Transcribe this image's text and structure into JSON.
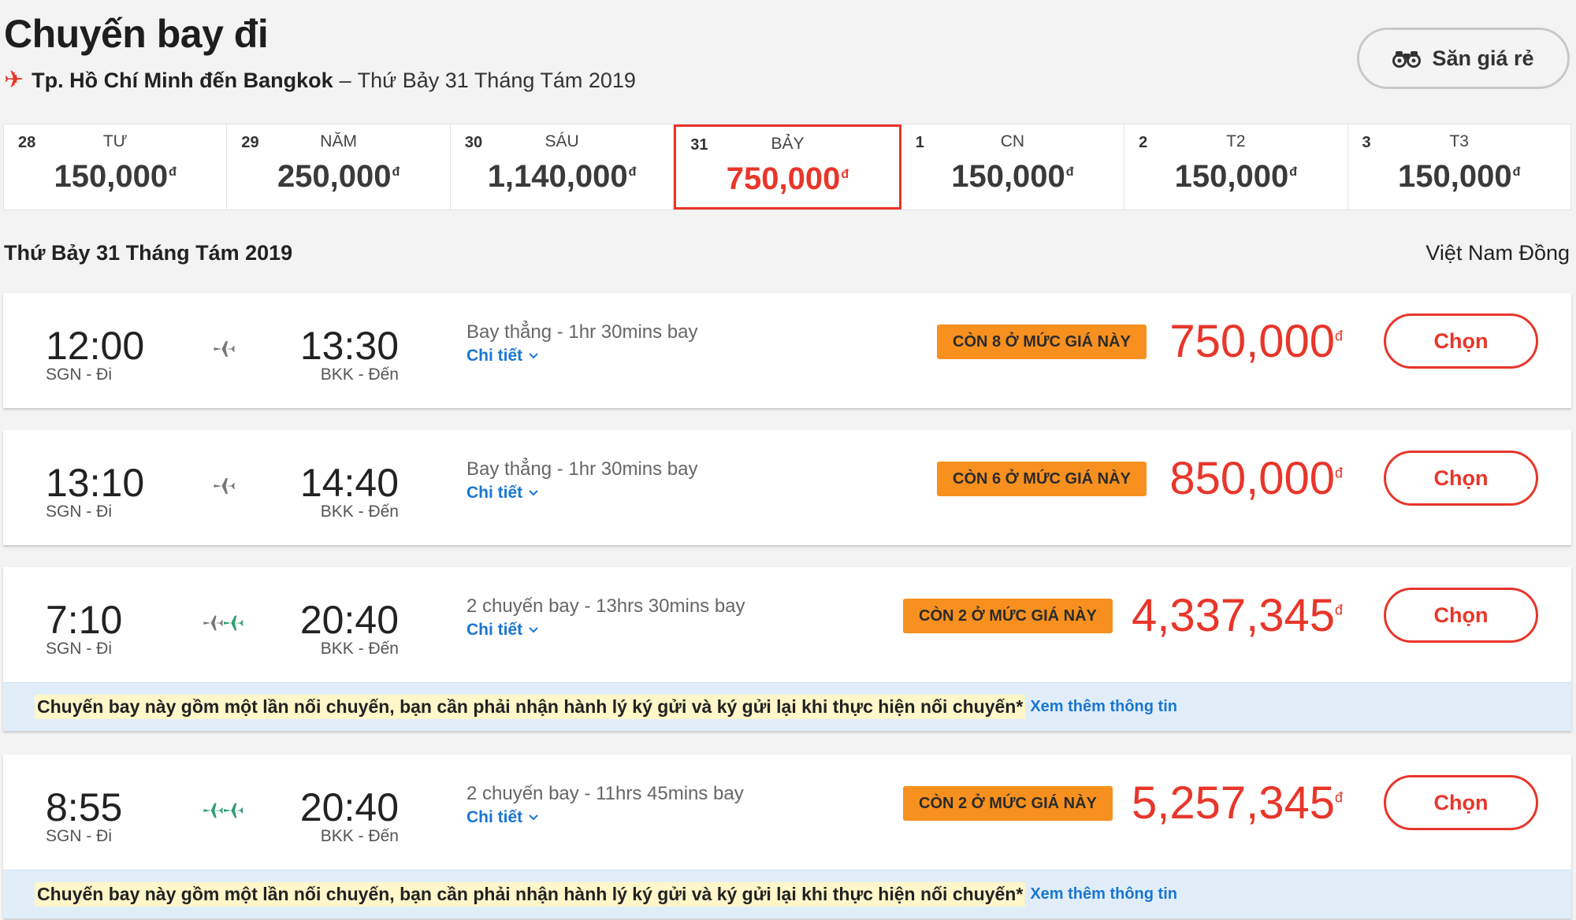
{
  "header": {
    "title": "Chuyến bay đi",
    "route": "Tp. Hồ Chí Minh đến Bangkok",
    "separator": "–",
    "date": "Thứ Bảy 31 Tháng Tám 2019",
    "deal_button_label": "Săn giá rẻ"
  },
  "date_strip": [
    {
      "day": "28",
      "weekday": "TƯ",
      "price": "150,000",
      "currency": "đ",
      "selected": false
    },
    {
      "day": "29",
      "weekday": "NĂM",
      "price": "250,000",
      "currency": "đ",
      "selected": false
    },
    {
      "day": "30",
      "weekday": "SÁU",
      "price": "1,140,000",
      "currency": "đ",
      "selected": false
    },
    {
      "day": "31",
      "weekday": "BẢY",
      "price": "750,000",
      "currency": "đ",
      "selected": true
    },
    {
      "day": "1",
      "weekday": "CN",
      "price": "150,000",
      "currency": "đ",
      "selected": false
    },
    {
      "day": "2",
      "weekday": "T2",
      "price": "150,000",
      "currency": "đ",
      "selected": false
    },
    {
      "day": "3",
      "weekday": "T3",
      "price": "150,000",
      "currency": "đ",
      "selected": false
    }
  ],
  "results": {
    "date_heading": "Thứ Bảy 31 Tháng Tám 2019",
    "currency_label": "Việt Nam Đồng"
  },
  "flights": [
    {
      "dep_time": "12:00",
      "dep_place": "SGN - Đi",
      "arr_time": "13:30",
      "arr_place": "BKK - Đến",
      "info": "Bay thẳng - 1hr 30mins bay",
      "details_label": "Chi tiết",
      "seats_label": "CÒN 8 Ở MỨC GIÁ NÀY",
      "price": "750,000",
      "currency": "đ",
      "choose_label": "Chọn",
      "connecting": false
    },
    {
      "dep_time": "13:10",
      "dep_place": "SGN - Đi",
      "arr_time": "14:40",
      "arr_place": "BKK - Đến",
      "info": "Bay thẳng - 1hr 30mins bay",
      "details_label": "Chi tiết",
      "seats_label": "CÒN 6 Ở MỨC GIÁ NÀY",
      "price": "850,000",
      "currency": "đ",
      "choose_label": "Chọn",
      "connecting": false
    },
    {
      "dep_time": "7:10",
      "dep_place": "SGN - Đi",
      "arr_time": "20:40",
      "arr_place": "BKK - Đến",
      "info": "2 chuyến bay - 13hrs 30mins bay",
      "details_label": "Chi tiết",
      "seats_label": "CÒN 2 Ở MỨC GIÁ NÀY",
      "price": "4,337,345",
      "currency": "đ",
      "choose_label": "Chọn",
      "connecting": true,
      "notice_text": "Chuyến bay này gồm một lần nối chuyến, bạn cần phải nhận hành lý ký gửi và ký gửi lại khi thực hiện nối chuyến*",
      "notice_link": "Xem thêm thông tin"
    },
    {
      "dep_time": "8:55",
      "dep_place": "SGN - Đi",
      "arr_time": "20:40",
      "arr_place": "BKK - Đến",
      "info": "2 chuyến bay - 11hrs 45mins bay",
      "details_label": "Chi tiết",
      "seats_label": "CÒN 2 Ở MỨC GIÁ NÀY",
      "price": "5,257,345",
      "currency": "đ",
      "choose_label": "Chọn",
      "connecting": true,
      "notice_text": "Chuyến bay này gồm một lần nối chuyến, bạn cần phải nhận hành lý ký gửi và ký gửi lại khi thực hiện nối chuyến*",
      "notice_link": "Xem thêm thông tin"
    }
  ],
  "colors": {
    "accent": "#e8362a",
    "badge": "#f7901e",
    "link": "#1976d2",
    "notice_bg": "#e1eefa",
    "plane_grey": "#777777",
    "plane_green": "#2f9e6e"
  }
}
